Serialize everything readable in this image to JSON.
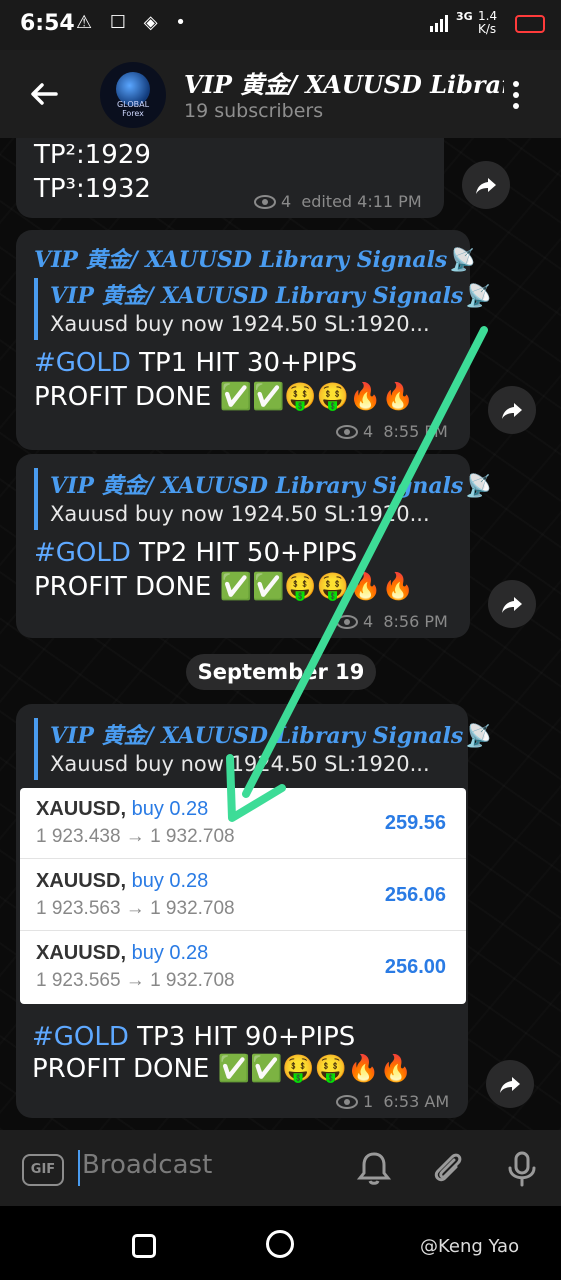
{
  "status_bar": {
    "time": "6:54",
    "left_icons": "⚠ ☐ ◈ •",
    "network": "3G",
    "speed": "1.4 K/s"
  },
  "header": {
    "title": "VIP 黄金/ XAUUSD Library",
    "subtitle": "19 subscribers",
    "avatar_text": "GLOBAL Forex"
  },
  "messages": [
    {
      "lines": [
        "TP²:1929",
        "TP³:1932"
      ],
      "views": "4",
      "time": "edited 4:11 PM"
    },
    {
      "forward_title": "VIP 黄金/ XAUUSD Library Signals📡",
      "reply_title": "VIP 黄金/ XAUUSD Library Signals📡",
      "reply_text": "Xauusd buy now 1924.50   SL:1920...",
      "hashtag": "#GOLD",
      "line1_rest": "  TP1 HIT 30+PIPS",
      "line2": "PROFIT DONE ✅✅🤑🤑🔥🔥",
      "views": "4",
      "time": "8:55 PM"
    },
    {
      "reply_title": "VIP 黄金/ XAUUSD Library Signals📡",
      "reply_text": "Xauusd buy now 1924.50   SL:1920...",
      "hashtag": "#GOLD",
      "line1_rest": "  TP2 HIT 50+PIPS",
      "line2": "PROFIT DONE ✅✅🤑🤑🔥🔥",
      "views": "4",
      "time": "8:56 PM"
    },
    {
      "reply_title": "VIP 黄金/ XAUUSD Library Signals📡",
      "reply_text": "Xauusd buy now 1924.50   SL:1920...",
      "hashtag": "#GOLD",
      "line1_rest": "  TP3 HIT 90+PIPS",
      "line2": "PROFIT DONE ✅✅🤑🤑🔥🔥",
      "views": "1",
      "time": "6:53 AM"
    }
  ],
  "date_divider": "September 19",
  "trades": [
    {
      "symbol": "XAUUSD,",
      "side": "buy 0.28",
      "prices": "1 923.438 → 1 932.708",
      "profit": "259.56"
    },
    {
      "symbol": "XAUUSD,",
      "side": "buy 0.28",
      "prices": "1 923.563 → 1 932.708",
      "profit": "256.06"
    },
    {
      "symbol": "XAUUSD,",
      "side": "buy 0.28",
      "prices": "1 923.565 → 1 932.708",
      "profit": "256.00"
    }
  ],
  "input": {
    "gif_label": "GIF",
    "placeholder": "Broadcast"
  },
  "watermark": "@Keng Yao",
  "colors": {
    "accent": "#4a9cf0",
    "arrow": "#3ddc97",
    "bubble": "#222325"
  }
}
